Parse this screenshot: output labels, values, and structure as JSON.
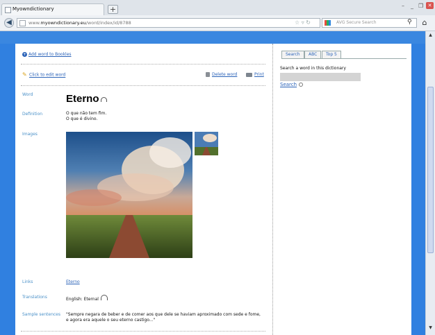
{
  "browser": {
    "tab_title": "Myowndictionary",
    "new_tab": "+",
    "url_prefix": "www.",
    "url_domain": "myowndictionary.eu",
    "url_path": "/word/index/id/8788",
    "search_placeholder": "AVG Secure Search"
  },
  "toolbar": {
    "add_bookmark": "Add word to Bookles",
    "edit_word": "Click to edit word",
    "delete_word": "Delete word",
    "print": "Print"
  },
  "entry": {
    "labels": {
      "word": "Word",
      "definition": "Definition",
      "images": "Images",
      "links": "Links",
      "translations": "Translations",
      "sample_sentences": "Sample sentences"
    },
    "word": "Eterno",
    "definition_lines": [
      "O que não tem fim.",
      "O que é divino."
    ],
    "links": "Eterno",
    "translation": "English: Eternal",
    "sample_sentence": "\"Sempre negara de beber e de comer aos que dele se haviam aproximado com sede e fome, e agora era aquele o seu eterno castigo...\""
  },
  "sidebar": {
    "tabs": [
      "Search",
      "ABC",
      "Top 5"
    ],
    "search_prompt": "Search a word in this dictionary",
    "search_input_value": "",
    "search_link": "Search"
  },
  "colors": {
    "page_background": "#3080e0",
    "link": "#2b63b8",
    "label": "#4a90c8"
  }
}
